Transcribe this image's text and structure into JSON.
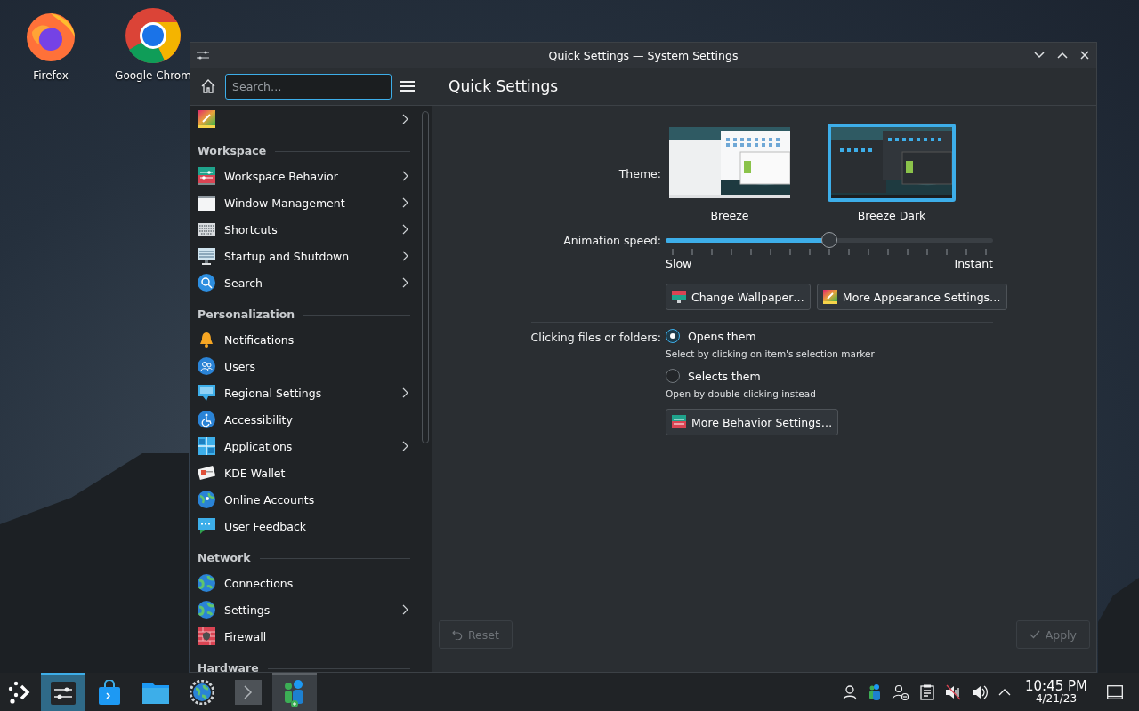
{
  "desktop_icons": [
    {
      "label": "Firefox"
    },
    {
      "label": "Google Chrom"
    }
  ],
  "window": {
    "title": "Quick Settings — System Settings"
  },
  "sidebar": {
    "search_placeholder": "Search…",
    "top_item": {
      "expandable": true
    },
    "sections": [
      {
        "title": "Workspace",
        "items": [
          {
            "label": "Workspace Behavior",
            "expandable": true
          },
          {
            "label": "Window Management",
            "expandable": true
          },
          {
            "label": "Shortcuts",
            "expandable": true
          },
          {
            "label": "Startup and Shutdown",
            "expandable": true
          },
          {
            "label": "Search",
            "expandable": true
          }
        ]
      },
      {
        "title": "Personalization",
        "items": [
          {
            "label": "Notifications",
            "expandable": false
          },
          {
            "label": "Users",
            "expandable": false
          },
          {
            "label": "Regional Settings",
            "expandable": true
          },
          {
            "label": "Accessibility",
            "expandable": false
          },
          {
            "label": "Applications",
            "expandable": true
          },
          {
            "label": "KDE Wallet",
            "expandable": false
          },
          {
            "label": "Online Accounts",
            "expandable": false
          },
          {
            "label": "User Feedback",
            "expandable": false
          }
        ]
      },
      {
        "title": "Network",
        "items": [
          {
            "label": "Connections",
            "expandable": false
          },
          {
            "label": "Settings",
            "expandable": true
          },
          {
            "label": "Firewall",
            "expandable": false
          }
        ]
      },
      {
        "title": "Hardware"
      }
    ]
  },
  "page": {
    "title": "Quick Settings",
    "theme": {
      "label": "Theme:",
      "options": [
        {
          "label": "Breeze",
          "kind": "light",
          "selected": false
        },
        {
          "label": "Breeze Dark",
          "kind": "dark",
          "selected": true
        }
      ]
    },
    "animation": {
      "label": "Animation speed:",
      "level": 0.5,
      "min_label": "Slow",
      "max_label": "Instant"
    },
    "appearance_buttons": [
      {
        "label": "Change Wallpaper…"
      },
      {
        "label": "More Appearance Settings…"
      }
    ],
    "clicking": {
      "label": "Clicking files or folders:",
      "options": [
        {
          "label": "Opens them",
          "hint": "Select by clicking on item's selection marker",
          "selected": true
        },
        {
          "label": "Selects them",
          "hint": "Open by double-clicking instead",
          "selected": false
        }
      ]
    },
    "behavior_button": {
      "label": "More Behavior Settings…"
    }
  },
  "footer": {
    "reset": {
      "label": "Reset",
      "disabled": true
    },
    "apply": {
      "label": "Apply",
      "disabled": true
    }
  },
  "taskbar": {
    "tasks": [
      {
        "selected": true,
        "hovered": false
      },
      {
        "selected": false,
        "hovered": false
      },
      {
        "selected": false,
        "hovered": false
      },
      {
        "selected": false,
        "hovered": false
      },
      {
        "selected": false,
        "hovered": false
      },
      {
        "selected": false,
        "hovered": true
      }
    ],
    "clock": {
      "time": "10:45 PM",
      "date": "4/21/23"
    }
  }
}
